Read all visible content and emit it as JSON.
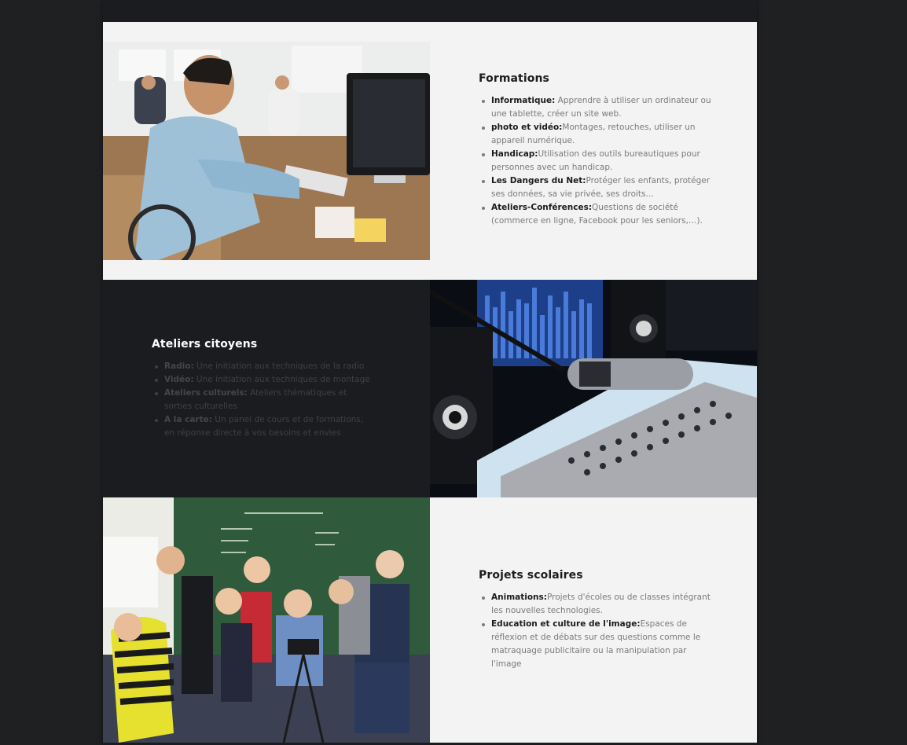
{
  "sections": {
    "formations": {
      "title": "Formations",
      "items": [
        {
          "label": "Informatique:",
          "text": " Apprendre à utiliser un ordinateur ou une tablette, créer un site web."
        },
        {
          "label": "photo et vidéo:",
          "text": "Montages, retouches, utiliser un appareil numérique."
        },
        {
          "label": "Handicap:",
          "text": "Utilisation des outils bureautiques pour personnes avec un handicap."
        },
        {
          "label": "Les Dangers du Net:",
          "text": "Protéger les enfants, protéger ses données, sa vie privée, ses droits…"
        },
        {
          "label": "Ateliers-Conférences:",
          "text": "Questions de société (commerce en ligne, Facebook pour les seniors,…)."
        }
      ]
    },
    "ateliers": {
      "title": "Ateliers citoyens",
      "items": [
        {
          "label": "Radio:",
          "text": " Une initiation aux techniques de la radio"
        },
        {
          "label": "Vidéo:",
          "text": " Une initiation aux techniques de montage"
        },
        {
          "label": "Ateliers culturels:",
          "text": " Ateliers thématiques et sorties culturelles"
        },
        {
          "label": "A la carte:",
          "text": " Un panel de cours et de formations, en réponse directe à vos besoins et envies"
        }
      ]
    },
    "projets": {
      "title": "Projets scolaires",
      "items": [
        {
          "label": "Animations:",
          "text": "Projets d'écoles ou de classes intégrant les nouvelles technologies."
        },
        {
          "label": "Education et culture de l'image:",
          "text": "Espaces de réflexion et de débats sur des questions comme le matraquage publicitaire ou la manipulation par l'image"
        }
      ]
    }
  },
  "colors": {
    "page_bg": "#1f2022",
    "dark_section": "#1b1c1f",
    "light_section": "#f3f3f3"
  }
}
